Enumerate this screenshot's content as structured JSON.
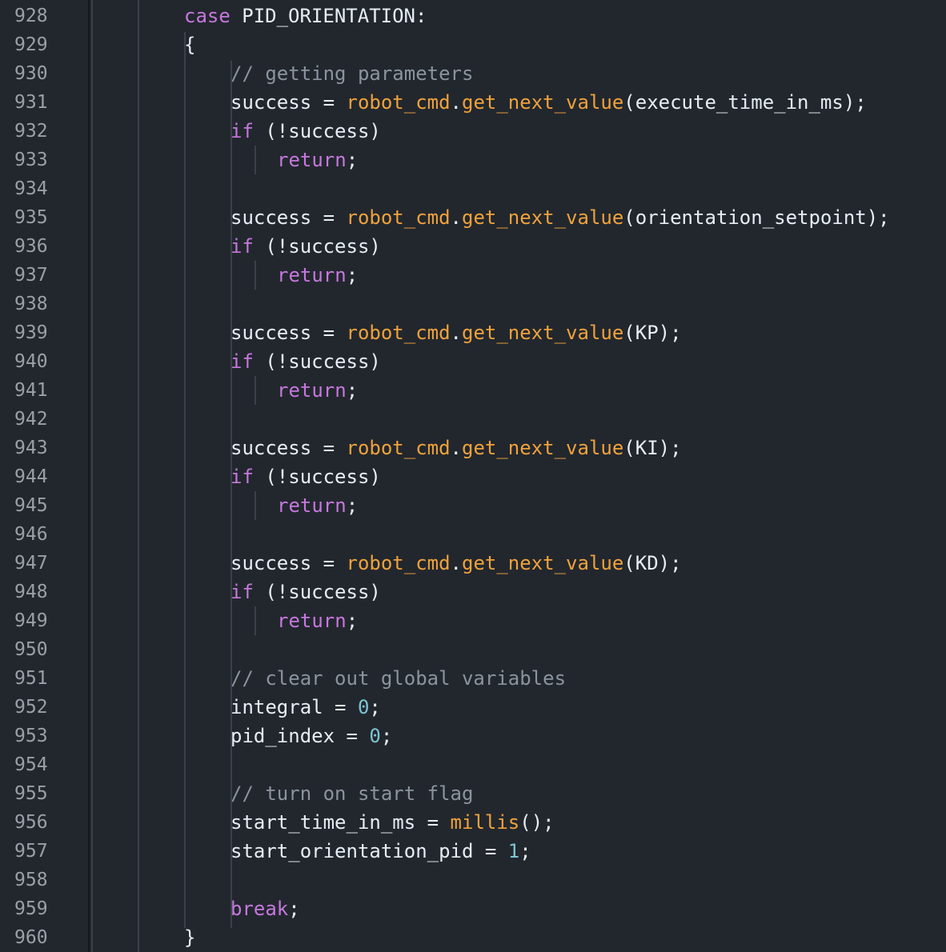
{
  "editor": {
    "colors": {
      "background": "#22272e",
      "keyword": "#c678dd",
      "function": "#f0a23b",
      "number": "#7ec4cf",
      "comment": "#8b949e",
      "text": "#e6edf3",
      "line_number": "#9aa0a6"
    },
    "lines": [
      {
        "number": "928",
        "indent": 2,
        "tokens": [
          {
            "t": "keyword",
            "v": "case"
          },
          {
            "t": "plain",
            "v": " PID_ORIENTATION:"
          }
        ]
      },
      {
        "number": "929",
        "indent": 2,
        "tokens": [
          {
            "t": "plain",
            "v": "{"
          }
        ]
      },
      {
        "number": "930",
        "indent": 3,
        "tokens": [
          {
            "t": "comment",
            "v": "// getting parameters"
          }
        ]
      },
      {
        "number": "931",
        "indent": 3,
        "tokens": [
          {
            "t": "plain",
            "v": "success = "
          },
          {
            "t": "object",
            "v": "robot_cmd"
          },
          {
            "t": "plain",
            "v": "."
          },
          {
            "t": "method",
            "v": "get_next_value"
          },
          {
            "t": "plain",
            "v": "(execute_time_in_ms);"
          }
        ]
      },
      {
        "number": "932",
        "indent": 3,
        "tokens": [
          {
            "t": "keyword",
            "v": "if"
          },
          {
            "t": "plain",
            "v": " (!success)"
          }
        ]
      },
      {
        "number": "933",
        "indent": 4,
        "tokens": [
          {
            "t": "keyword",
            "v": "return"
          },
          {
            "t": "plain",
            "v": ";"
          }
        ]
      },
      {
        "number": "934",
        "indent": 3,
        "tokens": []
      },
      {
        "number": "935",
        "indent": 3,
        "tokens": [
          {
            "t": "plain",
            "v": "success = "
          },
          {
            "t": "object",
            "v": "robot_cmd"
          },
          {
            "t": "plain",
            "v": "."
          },
          {
            "t": "method",
            "v": "get_next_value"
          },
          {
            "t": "plain",
            "v": "(orientation_setpoint);"
          }
        ]
      },
      {
        "number": "936",
        "indent": 3,
        "tokens": [
          {
            "t": "keyword",
            "v": "if"
          },
          {
            "t": "plain",
            "v": " (!success)"
          }
        ]
      },
      {
        "number": "937",
        "indent": 4,
        "tokens": [
          {
            "t": "keyword",
            "v": "return"
          },
          {
            "t": "plain",
            "v": ";"
          }
        ]
      },
      {
        "number": "938",
        "indent": 3,
        "tokens": []
      },
      {
        "number": "939",
        "indent": 3,
        "tokens": [
          {
            "t": "plain",
            "v": "success = "
          },
          {
            "t": "object",
            "v": "robot_cmd"
          },
          {
            "t": "plain",
            "v": "."
          },
          {
            "t": "method",
            "v": "get_next_value"
          },
          {
            "t": "plain",
            "v": "(KP);"
          }
        ]
      },
      {
        "number": "940",
        "indent": 3,
        "tokens": [
          {
            "t": "keyword",
            "v": "if"
          },
          {
            "t": "plain",
            "v": " (!success)"
          }
        ]
      },
      {
        "number": "941",
        "indent": 4,
        "tokens": [
          {
            "t": "keyword",
            "v": "return"
          },
          {
            "t": "plain",
            "v": ";"
          }
        ]
      },
      {
        "number": "942",
        "indent": 3,
        "tokens": []
      },
      {
        "number": "943",
        "indent": 3,
        "tokens": [
          {
            "t": "plain",
            "v": "success = "
          },
          {
            "t": "object",
            "v": "robot_cmd"
          },
          {
            "t": "plain",
            "v": "."
          },
          {
            "t": "method",
            "v": "get_next_value"
          },
          {
            "t": "plain",
            "v": "(KI);"
          }
        ]
      },
      {
        "number": "944",
        "indent": 3,
        "tokens": [
          {
            "t": "keyword",
            "v": "if"
          },
          {
            "t": "plain",
            "v": " (!success)"
          }
        ]
      },
      {
        "number": "945",
        "indent": 4,
        "tokens": [
          {
            "t": "keyword",
            "v": "return"
          },
          {
            "t": "plain",
            "v": ";"
          }
        ]
      },
      {
        "number": "946",
        "indent": 3,
        "tokens": []
      },
      {
        "number": "947",
        "indent": 3,
        "tokens": [
          {
            "t": "plain",
            "v": "success = "
          },
          {
            "t": "object",
            "v": "robot_cmd"
          },
          {
            "t": "plain",
            "v": "."
          },
          {
            "t": "method",
            "v": "get_next_value"
          },
          {
            "t": "plain",
            "v": "(KD);"
          }
        ]
      },
      {
        "number": "948",
        "indent": 3,
        "tokens": [
          {
            "t": "keyword",
            "v": "if"
          },
          {
            "t": "plain",
            "v": " (!success)"
          }
        ]
      },
      {
        "number": "949",
        "indent": 4,
        "tokens": [
          {
            "t": "keyword",
            "v": "return"
          },
          {
            "t": "plain",
            "v": ";"
          }
        ]
      },
      {
        "number": "950",
        "indent": 3,
        "tokens": []
      },
      {
        "number": "951",
        "indent": 3,
        "tokens": [
          {
            "t": "comment",
            "v": "// clear out global variables"
          }
        ]
      },
      {
        "number": "952",
        "indent": 3,
        "tokens": [
          {
            "t": "plain",
            "v": "integral = "
          },
          {
            "t": "number",
            "v": "0"
          },
          {
            "t": "plain",
            "v": ";"
          }
        ]
      },
      {
        "number": "953",
        "indent": 3,
        "tokens": [
          {
            "t": "plain",
            "v": "pid_index = "
          },
          {
            "t": "number",
            "v": "0"
          },
          {
            "t": "plain",
            "v": ";"
          }
        ]
      },
      {
        "number": "954",
        "indent": 3,
        "tokens": []
      },
      {
        "number": "955",
        "indent": 3,
        "tokens": [
          {
            "t": "comment",
            "v": "// turn on start flag"
          }
        ]
      },
      {
        "number": "956",
        "indent": 3,
        "tokens": [
          {
            "t": "plain",
            "v": "start_time_in_ms = "
          },
          {
            "t": "call",
            "v": "millis"
          },
          {
            "t": "plain",
            "v": "();"
          }
        ]
      },
      {
        "number": "957",
        "indent": 3,
        "tokens": [
          {
            "t": "plain",
            "v": "start_orientation_pid = "
          },
          {
            "t": "number",
            "v": "1"
          },
          {
            "t": "plain",
            "v": ";"
          }
        ]
      },
      {
        "number": "958",
        "indent": 3,
        "tokens": []
      },
      {
        "number": "959",
        "indent": 3,
        "tokens": [
          {
            "t": "keyword",
            "v": "break"
          },
          {
            "t": "plain",
            "v": ";"
          }
        ]
      },
      {
        "number": "960",
        "indent": 2,
        "tokens": [
          {
            "t": "plain",
            "v": "}"
          }
        ]
      }
    ]
  }
}
